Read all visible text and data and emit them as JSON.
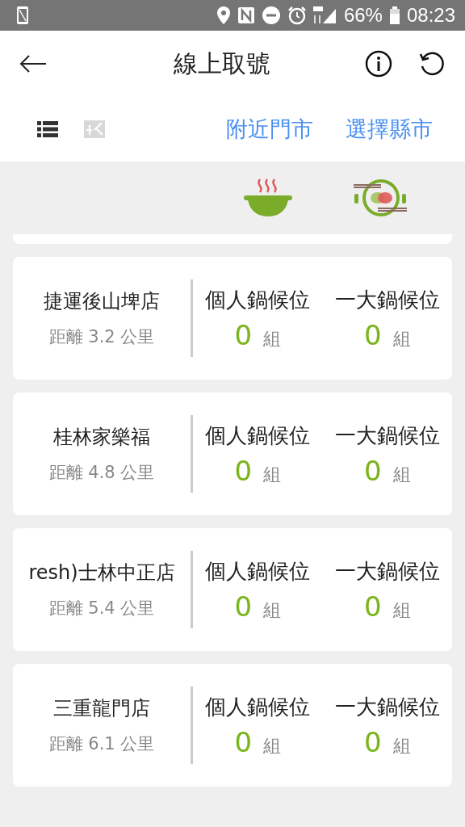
{
  "status_bar": {
    "battery": "66%",
    "time": "08:23"
  },
  "header": {
    "title": "線上取號"
  },
  "view_toggle": [
    {
      "kind": "list",
      "selected": true
    },
    {
      "kind": "grid",
      "selected": false
    }
  ],
  "links": [
    "附近門市",
    "選擇縣市"
  ],
  "stores": [
    {
      "name": "捷運後山埤店",
      "distance": "距離 3.2 公里",
      "queues": [
        {
          "label": "個人鍋候位",
          "count": "0",
          "unit": "組"
        },
        {
          "label": "一大鍋候位",
          "count": "0",
          "unit": "組"
        }
      ]
    },
    {
      "name": "桂林家樂福",
      "distance": "距離 4.8 公里",
      "queues": [
        {
          "label": "個人鍋候位",
          "count": "0",
          "unit": "組"
        },
        {
          "label": "一大鍋候位",
          "count": "0",
          "unit": "組"
        }
      ]
    },
    {
      "name": "resh)士林中正店",
      "distance": "距離 5.4 公里",
      "queues": [
        {
          "label": "個人鍋候位",
          "count": "0",
          "unit": "組"
        },
        {
          "label": "一大鍋候位",
          "count": "0",
          "unit": "組"
        }
      ]
    },
    {
      "name": "三重龍門店",
      "distance": "距離 6.1 公里",
      "queues": [
        {
          "label": "個人鍋候位",
          "count": "0",
          "unit": "組"
        },
        {
          "label": "一大鍋候位",
          "count": "0",
          "unit": "組"
        }
      ]
    }
  ]
}
